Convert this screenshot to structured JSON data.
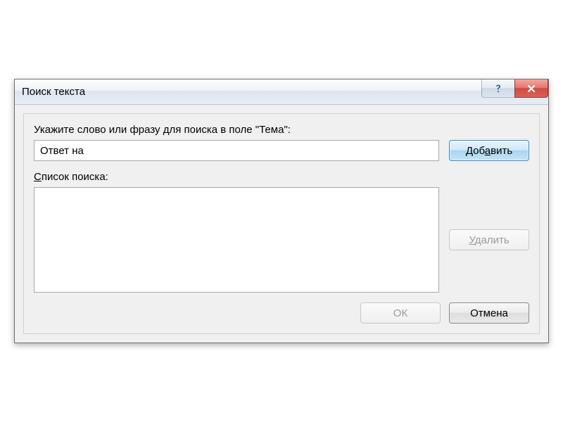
{
  "dialog": {
    "title": "Поиск текста",
    "prompt_pre": "Укажите слово или фразу для поиска в поле \"",
    "prompt_field": "Тема",
    "prompt_post": "\":",
    "search_value": "Ответ на",
    "list_label_pre": "",
    "list_label_hotkey": "С",
    "list_label_post": "писок поиска:",
    "list_items": []
  },
  "buttons": {
    "add_pre": "Доб",
    "add_hotkey": "а",
    "add_post": "вить",
    "delete_pre": "",
    "delete_hotkey": "У",
    "delete_post": "далить",
    "ok": "ОК",
    "cancel": "Отмена"
  }
}
